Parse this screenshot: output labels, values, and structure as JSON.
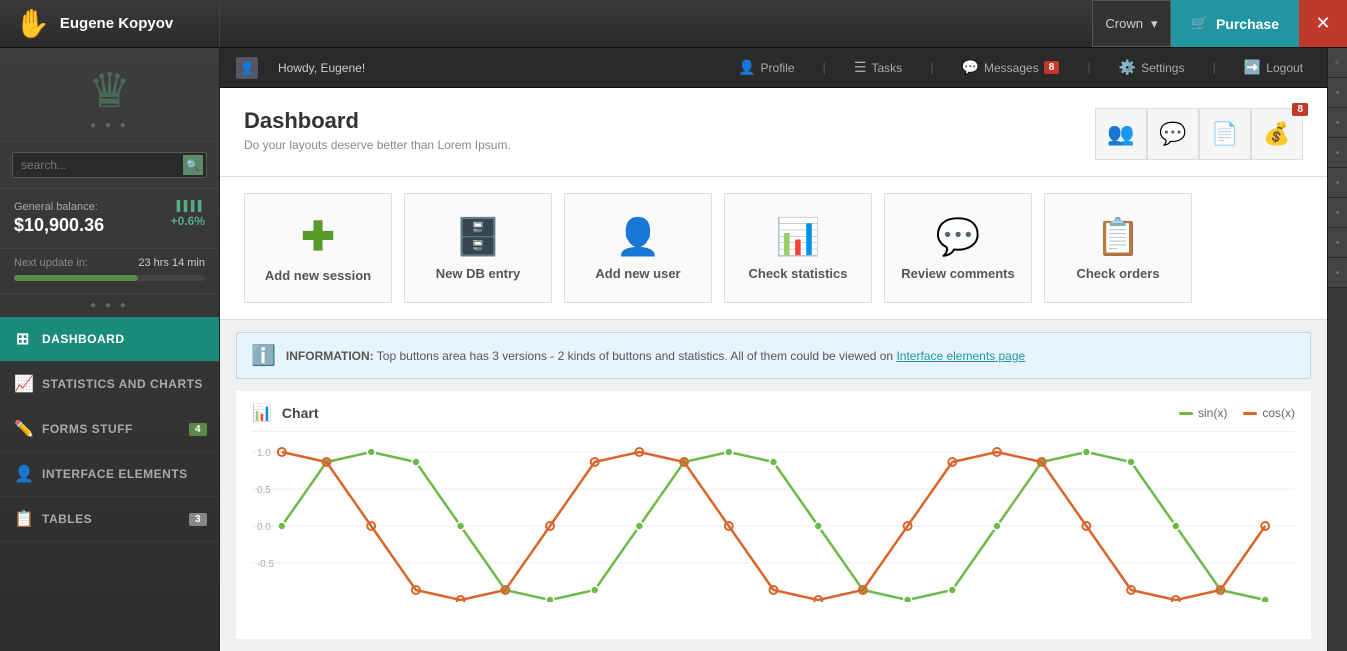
{
  "header": {
    "logo_icon": "✋",
    "user_name": "Eugene Kopyov",
    "crown_label": "Crown",
    "purchase_label": "Purchase",
    "close_icon": "✕",
    "cart_icon": "🛒"
  },
  "sub_header": {
    "howdy": "Howdy, Eugene!",
    "profile": "Profile",
    "tasks": "Tasks",
    "messages": "Messages",
    "messages_count": "8",
    "settings": "Settings",
    "logout": "Logout"
  },
  "dashboard": {
    "title": "Dashboard",
    "subtitle": "Do your layouts deserve better than Lorem Ipsum.",
    "badge_count": "8"
  },
  "quick_actions": [
    {
      "label": "Add new session",
      "icon": "➕"
    },
    {
      "label": "New DB entry",
      "icon": "🗄️"
    },
    {
      "label": "Add new user",
      "icon": "👤"
    },
    {
      "label": "Check statistics",
      "icon": "📊"
    },
    {
      "label": "Review comments",
      "icon": "💬"
    },
    {
      "label": "Check orders",
      "icon": "📋"
    }
  ],
  "info_bar": {
    "label": "INFORMATION:",
    "text": "Top buttons area has 3 versions - 2 kinds of buttons and statistics. All of them could be viewed on",
    "link": "Interface elements page"
  },
  "chart": {
    "title": "Chart",
    "legend": [
      {
        "label": "sin(x)",
        "color": "green"
      },
      {
        "label": "cos(x)",
        "color": "orange"
      }
    ],
    "y_labels": [
      "1.0",
      "0.5",
      "0.0",
      "-0.5"
    ]
  },
  "sidebar": {
    "balance_label": "General balance:",
    "balance_amount": "$10,900.36",
    "balance_percent": "+0.6%",
    "update_label": "Next update in:",
    "update_value": "23 hrs  14 min",
    "search_placeholder": "search...",
    "nav_items": [
      {
        "label": "Dashboard",
        "icon": "⊞",
        "active": true,
        "badge": null
      },
      {
        "label": "Statistics and Charts",
        "icon": "📈",
        "active": false,
        "badge": null
      },
      {
        "label": "Forms Stuff",
        "icon": "✏️",
        "active": false,
        "badge": "4"
      },
      {
        "label": "Interface Elements",
        "icon": "👤",
        "active": false,
        "badge": null
      },
      {
        "label": "Tables",
        "icon": "📋",
        "active": false,
        "badge": "3"
      }
    ]
  }
}
